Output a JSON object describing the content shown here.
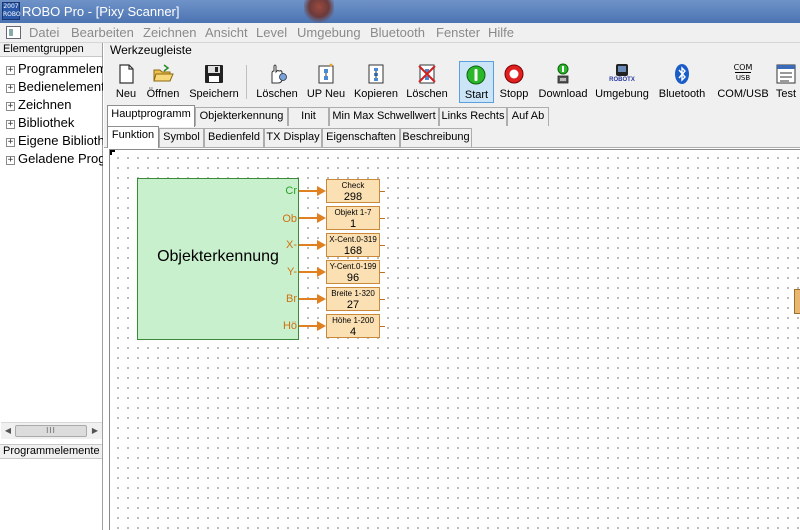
{
  "window": {
    "title": "ROBO Pro - [Pixy Scanner]",
    "icon_text": "2007 ROBO"
  },
  "menu": [
    "Datei",
    "Bearbeiten",
    "Zeichnen",
    "Ansicht",
    "Level",
    "Umgebung",
    "Bluetooth",
    "Fenster",
    "Hilfe"
  ],
  "left_panel": {
    "header": "Elementgruppen",
    "tree": [
      {
        "label": "Programmelemente",
        "expander": "+"
      },
      {
        "label": "Bedienelemente",
        "expander": "+"
      },
      {
        "label": "Zeichnen",
        "expander": "+"
      },
      {
        "label": "Bibliothek",
        "expander": "+"
      },
      {
        "label": "Eigene Bibliothek",
        "expander": "+"
      },
      {
        "label": "Geladene Programme",
        "expander": "+"
      }
    ],
    "scrollbar_grip": "III",
    "bottom_header": "Programmelemente"
  },
  "toolbar": {
    "header": "Werkzeugleiste",
    "tools": [
      {
        "label": "Neu",
        "icon": "new-document-icon"
      },
      {
        "label": "Öffnen",
        "icon": "open-folder-icon"
      },
      {
        "label": "Speichern",
        "icon": "save-disk-icon"
      },
      {
        "label": "Löschen",
        "icon": "delete-hand-icon"
      },
      {
        "label": "UP Neu",
        "icon": "new-subprogram-icon"
      },
      {
        "label": "Kopieren",
        "icon": "copy-icon"
      },
      {
        "label": "Löschen",
        "icon": "delete-x-icon"
      },
      {
        "label": "Start",
        "icon": "start-green-icon"
      },
      {
        "label": "Stopp",
        "icon": "stop-red-icon"
      },
      {
        "label": "Download",
        "icon": "download-icon"
      },
      {
        "label": "Umgebung",
        "icon": "robotx-icon"
      },
      {
        "label": "Bluetooth",
        "icon": "bluetooth-icon"
      },
      {
        "label": "COM/USB",
        "icon": "com-usb-icon"
      },
      {
        "label": "Test",
        "icon": "test-icon"
      }
    ],
    "robotx_text": "ROBOTX",
    "com_text": "COM",
    "usb_text": "USB"
  },
  "tabs_main": [
    "Hauptprogramm",
    "Objekterkennung",
    "Init",
    "Min Max Schwellwert",
    "Links Rechts",
    "Auf Ab"
  ],
  "tabs_sub": [
    "Funktion",
    "Symbol",
    "Bedienfeld",
    "TX Display",
    "Eigenschaften",
    "Beschreibung"
  ],
  "block": {
    "label": "Objekterkennung",
    "ports": [
      "Cr",
      "Ob",
      "X-",
      "Y-",
      "Br",
      "Hö"
    ]
  },
  "panels": [
    {
      "title": "Check",
      "value": "298"
    },
    {
      "title": "Objekt 1-7",
      "value": "1"
    },
    {
      "title": "X-Cent.0-319",
      "value": "168"
    },
    {
      "title": "Y-Cent.0-199",
      "value": "96"
    },
    {
      "title": "Breite 1-320",
      "value": "27"
    },
    {
      "title": "Höhe 1-200",
      "value": "4"
    }
  ],
  "colors": {
    "block_fill": "#c8f0cc",
    "panel_fill": "#fbe0b4",
    "wire": "#e08020",
    "port_green": "#2aa02a",
    "port_orange": "#d07010"
  }
}
